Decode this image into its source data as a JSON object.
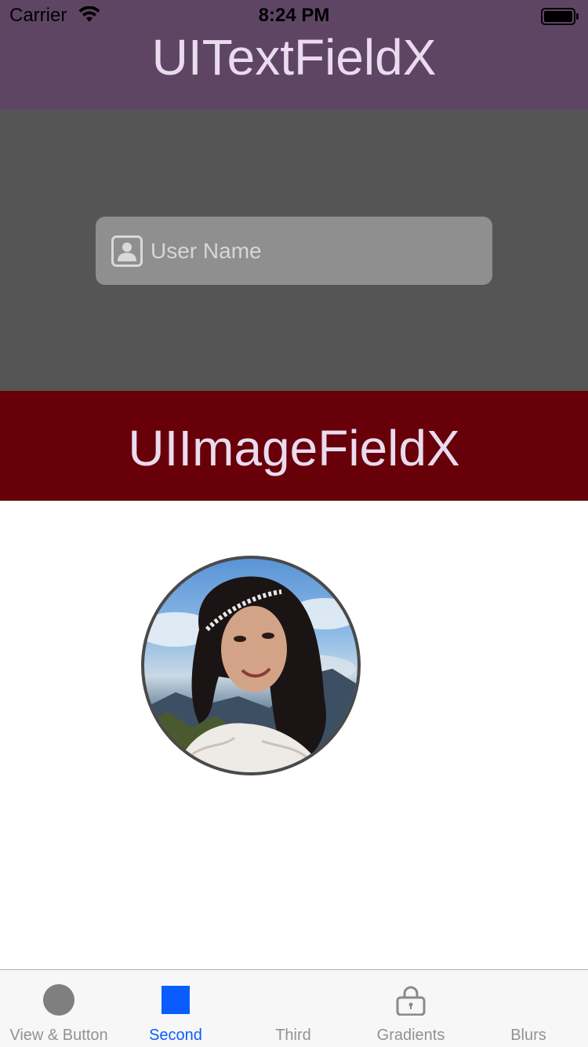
{
  "status_bar": {
    "carrier": "Carrier",
    "time": "8:24 PM"
  },
  "sections": {
    "textfield_title": "UITextFieldX",
    "imagefield_title": "UIImageFieldX"
  },
  "text_field": {
    "placeholder": "User Name",
    "value": ""
  },
  "colors": {
    "header_purple": "#5f4564",
    "grey_background": "#555555",
    "header_maroon": "#670009",
    "tab_active": "#0a5cff",
    "tab_inactive": "#929292"
  },
  "tab_bar": {
    "tabs": [
      {
        "label": "View & Button",
        "icon": "circle-icon",
        "active": false
      },
      {
        "label": "Second",
        "icon": "square-icon",
        "active": true
      },
      {
        "label": "Third",
        "icon": "",
        "active": false
      },
      {
        "label": "Gradients",
        "icon": "lock-icon",
        "active": false
      },
      {
        "label": "Blurs",
        "icon": "",
        "active": false
      }
    ]
  }
}
